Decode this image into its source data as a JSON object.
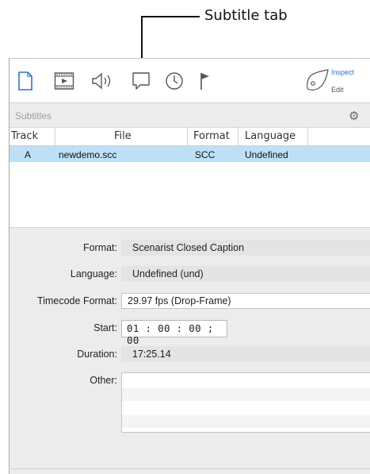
{
  "callout": {
    "label": "Subtitle tab"
  },
  "toolbar": {
    "icons": [
      "document-icon",
      "movie-icon",
      "speaker-icon",
      "subtitle-icon",
      "clock-icon",
      "flag-icon"
    ],
    "inspect_label": "Inspect",
    "edit_label": "Edit",
    "accent_color": "#2a78d4"
  },
  "section": {
    "title": "Subtitles"
  },
  "table": {
    "headers": [
      "Track",
      "File",
      "Format",
      "Language"
    ],
    "rows": [
      {
        "track": "A",
        "file": "newdemo.scc",
        "format": "SCC",
        "language": "Undefined"
      }
    ],
    "selected_color": "#bde0f7"
  },
  "details": {
    "format_label": "Format:",
    "format_value": "Scenarist Closed Caption",
    "language_label": "Language:",
    "language_value": "Undefined (und)",
    "timecode_label": "Timecode Format:",
    "timecode_value": "29.97 fps (Drop-Frame)",
    "start_label": "Start:",
    "start_value": "01 : 00 : 00 ; 00",
    "duration_label": "Duration:",
    "duration_value": "17:25.14",
    "other_label": "Other:",
    "other_value": ""
  }
}
